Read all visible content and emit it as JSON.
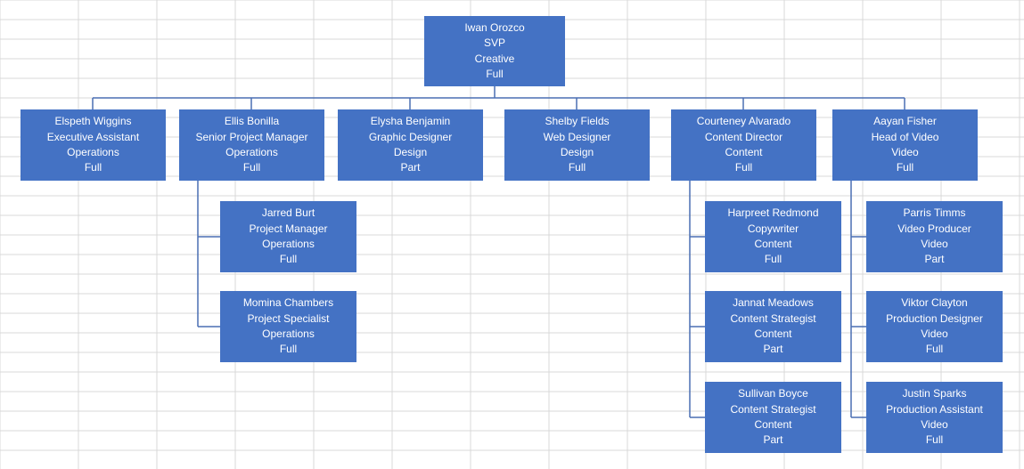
{
  "chart_data": {
    "type": "org-chart",
    "root": {
      "name": "Iwan Orozco",
      "title": "SVP",
      "dept": "Creative",
      "status": "Full",
      "children": [
        {
          "name": "Elspeth Wiggins",
          "title": "Executive Assistant",
          "dept": "Operations",
          "status": "Full"
        },
        {
          "name": "Ellis Bonilla",
          "title": "Senior Project Manager",
          "dept": "Operations",
          "status": "Full",
          "children": [
            {
              "name": "Jarred Burt",
              "title": "Project Manager",
              "dept": "Operations",
              "status": "Full"
            },
            {
              "name": "Momina Chambers",
              "title": "Project Specialist",
              "dept": "Operations",
              "status": "Full"
            }
          ]
        },
        {
          "name": "Elysha Benjamin",
          "title": "Graphic Designer",
          "dept": "Design",
          "status": "Part"
        },
        {
          "name": "Shelby Fields",
          "title": "Web Designer",
          "dept": "Design",
          "status": "Full"
        },
        {
          "name": "Courteney Alvarado",
          "title": "Content Director",
          "dept": "Content",
          "status": "Full",
          "children": [
            {
              "name": "Harpreet Redmond",
              "title": "Copywriter",
              "dept": "Content",
              "status": "Full"
            },
            {
              "name": "Jannat Meadows",
              "title": "Content Strategist",
              "dept": "Content",
              "status": "Part"
            },
            {
              "name": "Sullivan Boyce",
              "title": "Content Strategist",
              "dept": "Content",
              "status": "Part"
            }
          ]
        },
        {
          "name": "Aayan Fisher",
          "title": "Head of Video",
          "dept": "Video",
          "status": "Full",
          "children": [
            {
              "name": "Parris Timms",
              "title": "Video Producer",
              "dept": "Video",
              "status": "Part"
            },
            {
              "name": "Viktor Clayton",
              "title": "Production Designer",
              "dept": "Video",
              "status": "Full"
            },
            {
              "name": "Justin Sparks",
              "title": "Production Assistant",
              "dept": "Video",
              "status": "Full"
            }
          ]
        }
      ]
    }
  },
  "nodes": {
    "root": {
      "name": "Iwan Orozco",
      "title": "SVP",
      "dept": "Creative",
      "status": "Full"
    },
    "c0": {
      "name": "Elspeth Wiggins",
      "title": "Executive Assistant",
      "dept": "Operations",
      "status": "Full"
    },
    "c1": {
      "name": "Ellis Bonilla",
      "title": "Senior Project Manager",
      "dept": "Operations",
      "status": "Full"
    },
    "c2": {
      "name": "Elysha Benjamin",
      "title": "Graphic Designer",
      "dept": "Design",
      "status": "Part"
    },
    "c3": {
      "name": "Shelby Fields",
      "title": "Web Designer",
      "dept": "Design",
      "status": "Full"
    },
    "c4": {
      "name": "Courteney Alvarado",
      "title": "Content Director",
      "dept": "Content",
      "status": "Full"
    },
    "c5": {
      "name": "Aayan Fisher",
      "title": "Head of Video",
      "dept": "Video",
      "status": "Full"
    },
    "c1a": {
      "name": "Jarred Burt",
      "title": "Project Manager",
      "dept": "Operations",
      "status": "Full"
    },
    "c1b": {
      "name": "Momina Chambers",
      "title": "Project Specialist",
      "dept": "Operations",
      "status": "Full"
    },
    "c4a": {
      "name": "Harpreet Redmond",
      "title": "Copywriter",
      "dept": "Content",
      "status": "Full"
    },
    "c4b": {
      "name": "Jannat Meadows",
      "title": "Content Strategist",
      "dept": "Content",
      "status": "Part"
    },
    "c4c": {
      "name": "Sullivan Boyce",
      "title": "Content Strategist",
      "dept": "Content",
      "status": "Part"
    },
    "c5a": {
      "name": "Parris Timms",
      "title": "Video Producer",
      "dept": "Video",
      "status": "Part"
    },
    "c5b": {
      "name": "Viktor Clayton",
      "title": "Production Designer",
      "dept": "Video",
      "status": "Full"
    },
    "c5c": {
      "name": "Justin Sparks",
      "title": "Production Assistant",
      "dept": "Video",
      "status": "Full"
    }
  }
}
